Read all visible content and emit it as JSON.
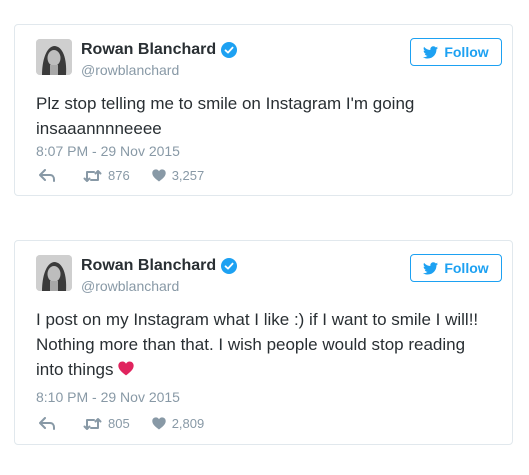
{
  "tweets": [
    {
      "user": {
        "name": "Rowan Blanchard",
        "handle": "@rowblanchard"
      },
      "follow_label": "Follow",
      "text": "Plz stop telling me to smile on Instagram I'm going insaaannnneeee",
      "timestamp": "8:07 PM - 29 Nov 2015",
      "retweets": "876",
      "likes": "3,257"
    },
    {
      "user": {
        "name": "Rowan Blanchard",
        "handle": "@rowblanchard"
      },
      "follow_label": "Follow",
      "text": "I post on my Instagram what I like :) if I want to smile I will!! Nothing more than that. I wish people would stop reading into things",
      "timestamp": "8:10 PM - 29 Nov 2015",
      "retweets": "805",
      "likes": "2,809"
    }
  ],
  "colors": {
    "accent": "#1da1f2",
    "muted": "#8899a6",
    "text": "#292f33",
    "heart_emoji": "#e0245e"
  },
  "icons": [
    "verified-badge-icon",
    "twitter-bird-icon",
    "reply-icon",
    "retweet-icon",
    "heart-icon",
    "red-heart-emoji-icon"
  ]
}
